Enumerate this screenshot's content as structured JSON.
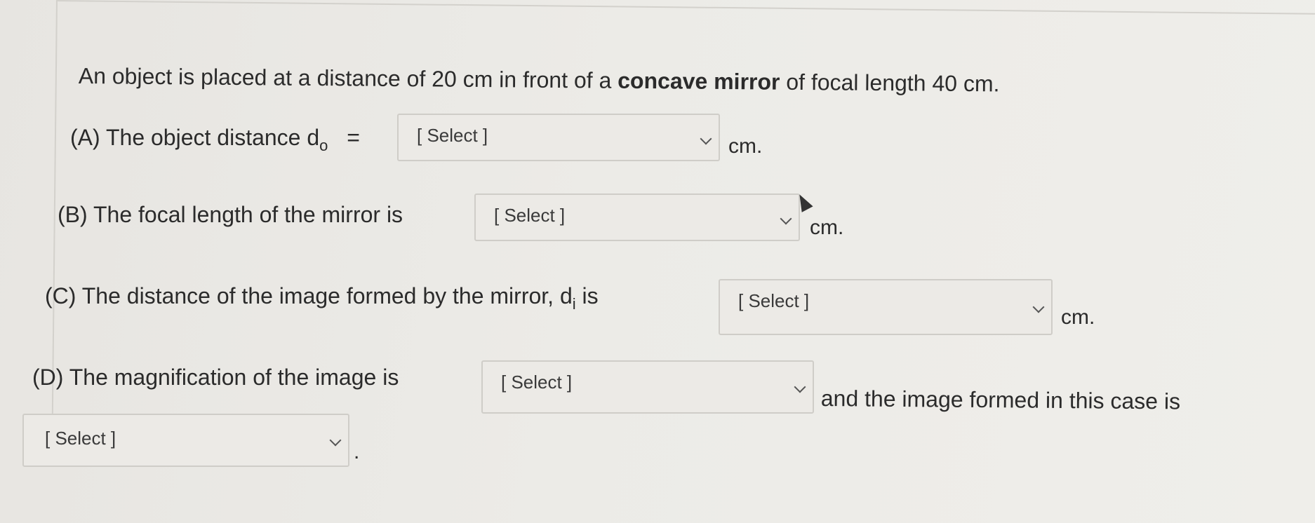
{
  "question": {
    "prefix": "An object is placed at a distance of 20 cm in front of a ",
    "bold": "concave mirror",
    "suffix": " of focal length 40 cm."
  },
  "part_a": {
    "label": "(A) The object distance d",
    "subscript": "o",
    "equals": "=",
    "select": "[ Select ]",
    "unit": "cm."
  },
  "part_b": {
    "label": "(B) The focal length of the mirror is",
    "select": "[ Select ]",
    "unit": "cm."
  },
  "part_c": {
    "label": "(C) The distance of the image formed by the mirror, d",
    "subscript": "i",
    "label_end": " is",
    "select": "[ Select ]",
    "unit": "cm."
  },
  "part_d": {
    "label": "(D) The magnification of the image is",
    "select": "[ Select ]",
    "trailing": "and the image formed in this case is",
    "select2": "[ Select ]",
    "period": "."
  }
}
